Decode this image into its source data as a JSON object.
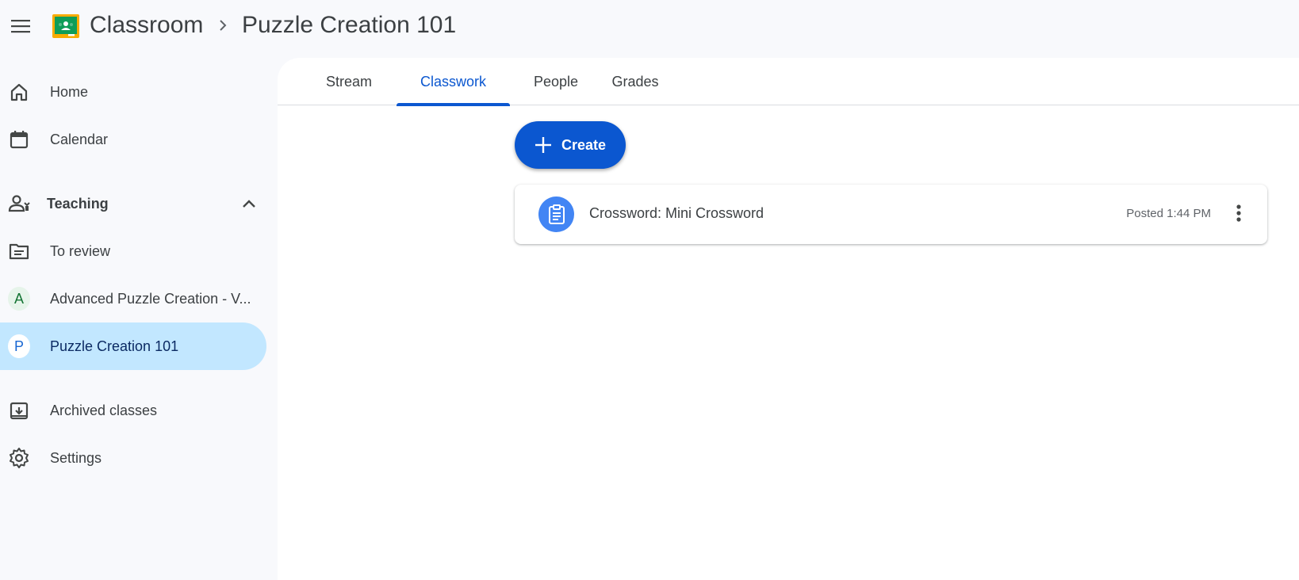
{
  "header": {
    "app_title": "Classroom",
    "class_title": "Puzzle Creation 101"
  },
  "sidebar": {
    "items": [
      {
        "label": "Home",
        "icon": "home-icon"
      },
      {
        "label": "Calendar",
        "icon": "calendar-icon"
      }
    ],
    "teaching": {
      "label": "Teaching",
      "icon": "teacher-icon"
    },
    "teaching_items": [
      {
        "label": "To review",
        "icon": "folder-review-icon"
      },
      {
        "label": "Advanced Puzzle Creation - V...",
        "avatar": "A"
      },
      {
        "label": "Puzzle Creation 101",
        "avatar": "P",
        "active": true
      }
    ],
    "bottom_items": [
      {
        "label": "Archived classes",
        "icon": "archive-icon"
      },
      {
        "label": "Settings",
        "icon": "gear-icon"
      }
    ]
  },
  "tabs": [
    {
      "label": "Stream"
    },
    {
      "label": "Classwork",
      "active": true
    },
    {
      "label": "People"
    },
    {
      "label": "Grades"
    }
  ],
  "create_button": {
    "label": "Create"
  },
  "classwork": {
    "items": [
      {
        "title": "Crossword: Mini Crossword",
        "posted": "Posted 1:44 PM",
        "icon": "assignment-icon"
      }
    ]
  },
  "colors": {
    "accent": "#0b57d0",
    "active_nav_bg": "#c2e7ff",
    "assignment_icon_bg": "#4285f4"
  }
}
